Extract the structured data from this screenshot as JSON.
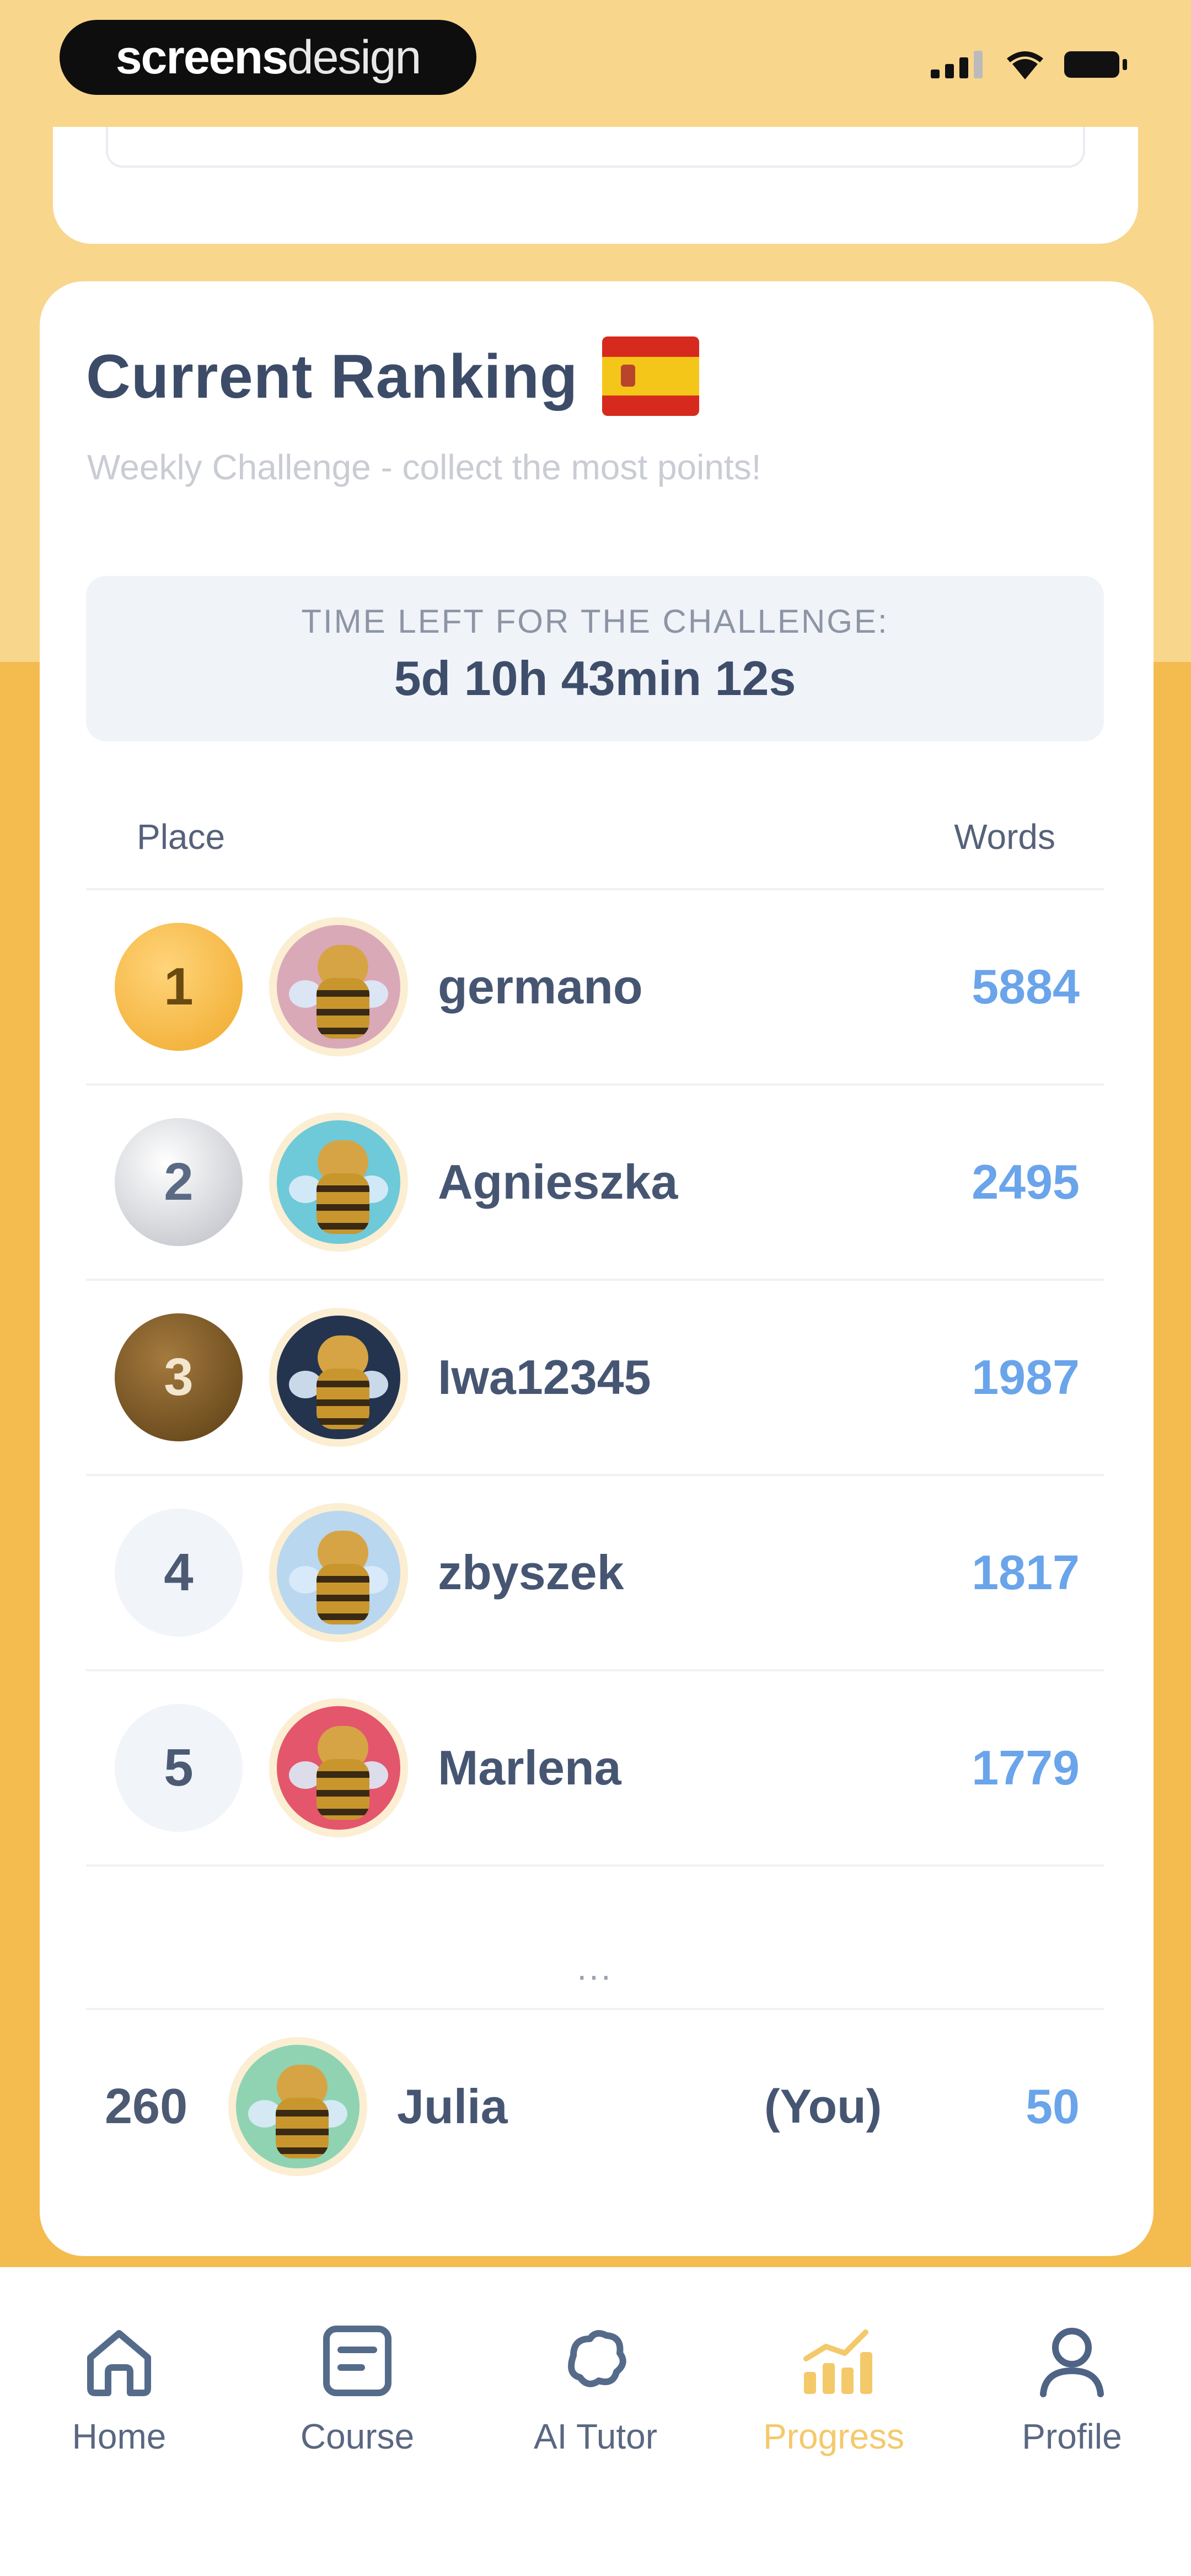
{
  "status_bar": {
    "brand_part1": "screens",
    "brand_part2": "design",
    "icons": [
      "signal-icon",
      "wifi-icon",
      "battery-icon"
    ]
  },
  "ranking": {
    "title": "Current Ranking",
    "flag": "spain-flag-icon",
    "subtitle": "Weekly Challenge - collect the most points!",
    "timer_label": "TIME LEFT FOR THE CHALLENGE:",
    "timer_value": "5d 10h 43min 12s",
    "col_place": "Place",
    "col_words": "Words",
    "rows": [
      {
        "place": "1",
        "name": "germano",
        "words": "5884",
        "medal": "gold"
      },
      {
        "place": "2",
        "name": "Agnieszka",
        "words": "2495",
        "medal": "silver"
      },
      {
        "place": "3",
        "name": "Iwa12345",
        "words": "1987",
        "medal": "bronze"
      },
      {
        "place": "4",
        "name": "zbyszek",
        "words": "1817",
        "medal": "plain"
      },
      {
        "place": "5",
        "name": "Marlena",
        "words": "1779",
        "medal": "plain"
      }
    ],
    "ellipsis": "...",
    "me": {
      "place": "260",
      "name": "Julia",
      "tag": "(You)",
      "words": "50"
    }
  },
  "tabs": [
    {
      "label": "Home",
      "icon": "home-icon"
    },
    {
      "label": "Course",
      "icon": "course-icon"
    },
    {
      "label": "AI Tutor",
      "icon": "ai-tutor-icon"
    },
    {
      "label": "Progress",
      "icon": "progress-icon",
      "active": true
    },
    {
      "label": "Profile",
      "icon": "profile-icon"
    }
  ],
  "colors": {
    "accent": "#f4bb4f",
    "active_tab": "#f4c96a",
    "score": "#6aa4ea",
    "text": "#3c4c68"
  }
}
